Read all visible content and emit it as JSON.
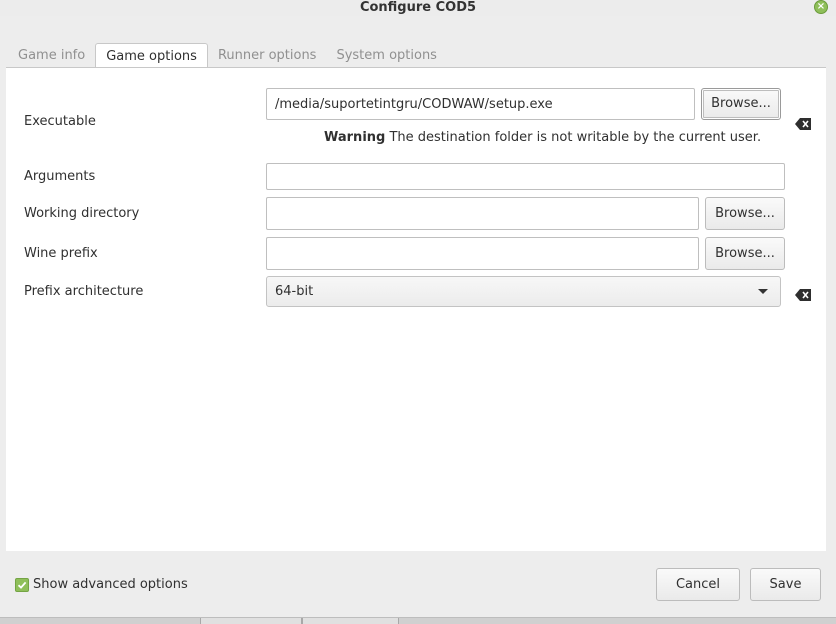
{
  "window": {
    "title": "Configure COD5"
  },
  "tabs": [
    {
      "label": "Game info",
      "active": false
    },
    {
      "label": "Game options",
      "active": true
    },
    {
      "label": "Runner options",
      "active": false
    },
    {
      "label": "System options",
      "active": false
    }
  ],
  "form": {
    "executable": {
      "label": "Executable",
      "value": "/media/suportetintgru/CODWAW/setup.exe",
      "browse_label": "Browse..."
    },
    "warning": {
      "strong": "Warning",
      "text": " The destination folder is not writable by the current user."
    },
    "arguments": {
      "label": "Arguments",
      "value": ""
    },
    "working_directory": {
      "label": "Working directory",
      "value": "",
      "browse_label": "Browse..."
    },
    "wine_prefix": {
      "label": "Wine prefix",
      "value": "",
      "browse_label": "Browse..."
    },
    "prefix_architecture": {
      "label": "Prefix architecture",
      "selected": "64-bit"
    }
  },
  "footer": {
    "show_advanced_label": "Show advanced options",
    "show_advanced_checked": true,
    "cancel_label": "Cancel",
    "save_label": "Save"
  },
  "colors": {
    "accent": "#8fbf5a"
  }
}
